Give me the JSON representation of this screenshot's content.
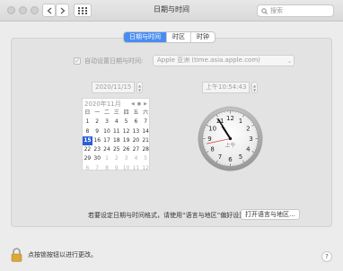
{
  "window": {
    "title": "日期与时间",
    "search_placeholder": "搜索"
  },
  "tabs": [
    {
      "label": "日期与时间",
      "active": true
    },
    {
      "label": "时区",
      "active": false
    },
    {
      "label": "时钟",
      "active": false
    }
  ],
  "auto_time": {
    "label": "自动设置日期与时间:",
    "checked": true,
    "server": "Apple 亚洲 (time.asia.apple.com)"
  },
  "date_field": "2020/11/15",
  "time_field": "上午10:54:43",
  "calendar": {
    "header": "2020年11月",
    "nav": [
      "◀",
      "●",
      "▶"
    ],
    "weekdays": [
      "日",
      "一",
      "二",
      "三",
      "四",
      "五",
      "六"
    ],
    "days": [
      {
        "d": "1"
      },
      {
        "d": "2"
      },
      {
        "d": "3"
      },
      {
        "d": "4"
      },
      {
        "d": "5"
      },
      {
        "d": "6"
      },
      {
        "d": "7"
      },
      {
        "d": "8"
      },
      {
        "d": "9"
      },
      {
        "d": "10"
      },
      {
        "d": "11"
      },
      {
        "d": "12"
      },
      {
        "d": "13"
      },
      {
        "d": "14"
      },
      {
        "d": "15",
        "selected": true
      },
      {
        "d": "16"
      },
      {
        "d": "17"
      },
      {
        "d": "18"
      },
      {
        "d": "19"
      },
      {
        "d": "20"
      },
      {
        "d": "21"
      },
      {
        "d": "22"
      },
      {
        "d": "23"
      },
      {
        "d": "24"
      },
      {
        "d": "25"
      },
      {
        "d": "26"
      },
      {
        "d": "27"
      },
      {
        "d": "28"
      },
      {
        "d": "29"
      },
      {
        "d": "30"
      },
      {
        "d": "1",
        "other": true
      },
      {
        "d": "2",
        "other": true
      },
      {
        "d": "3",
        "other": true
      },
      {
        "d": "4",
        "other": true
      },
      {
        "d": "5",
        "other": true
      },
      {
        "d": "6",
        "other": true
      },
      {
        "d": "7",
        "other": true
      },
      {
        "d": "8",
        "other": true
      },
      {
        "d": "9",
        "other": true
      },
      {
        "d": "10",
        "other": true
      },
      {
        "d": "11",
        "other": true
      },
      {
        "d": "12",
        "other": true
      }
    ]
  },
  "clock": {
    "ampm": "上午",
    "numbers": [
      "12",
      "1",
      "2",
      "3",
      "4",
      "5",
      "6",
      "7",
      "8",
      "9",
      "10",
      "11"
    ],
    "hour": 10,
    "minute": 54,
    "second": 43
  },
  "footer": {
    "region_hint": "若要设定日期与时间格式，请使用“语言与地区”偏好设置。",
    "open_button": "打开语言与地区...",
    "lock_text": "点按锁按钮以进行更改。",
    "help": "?"
  },
  "colors": {
    "accent": "#4a8cf0",
    "selected_day": "#2b5fd6",
    "second_hand": "#d0342c"
  }
}
